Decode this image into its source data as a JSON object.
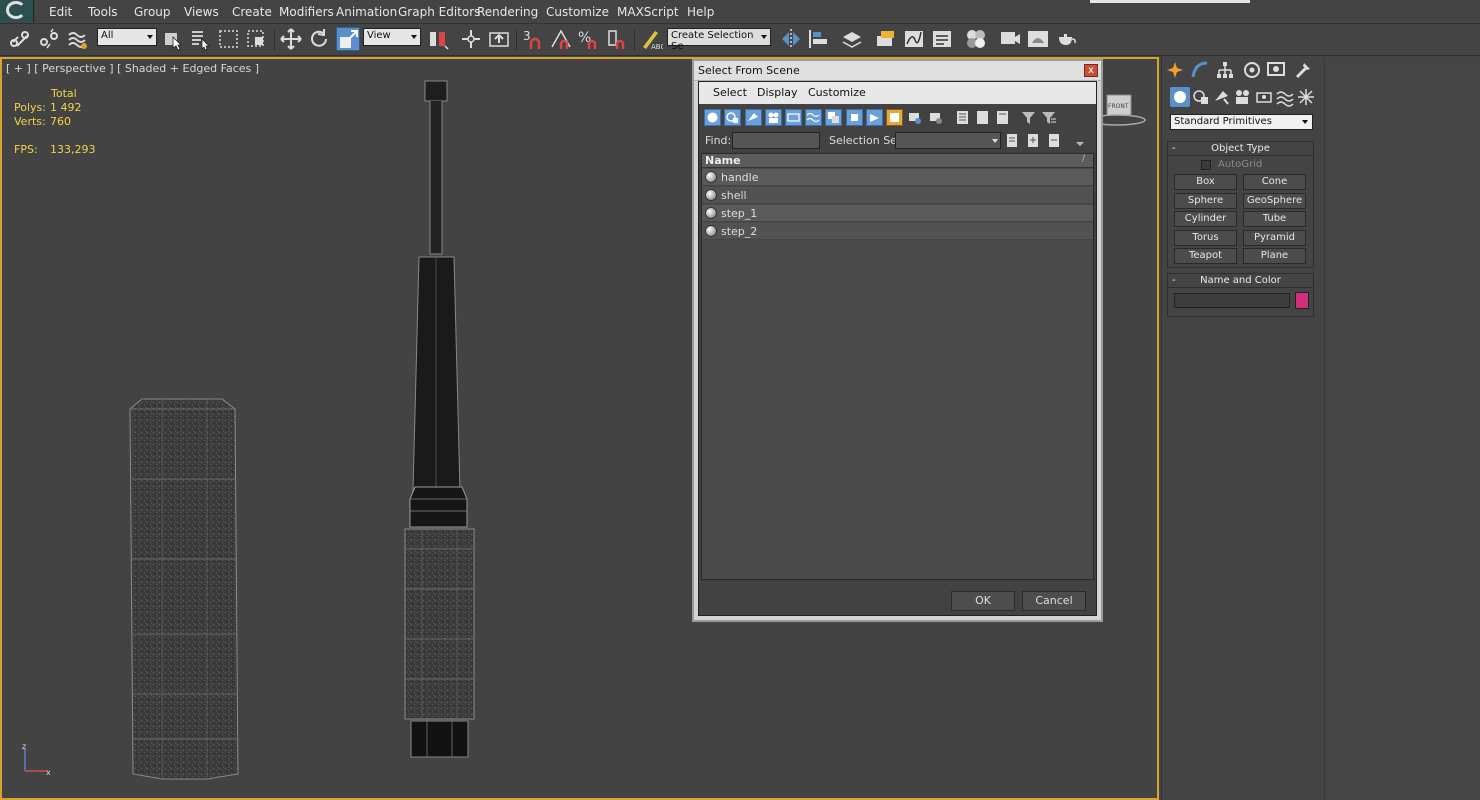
{
  "menubar": {
    "items": [
      "Edit",
      "Tools",
      "Group",
      "Views",
      "Create",
      "Modifiers",
      "Animation",
      "Graph Editors",
      "Rendering",
      "Customize",
      "MAXScript",
      "Help"
    ]
  },
  "toolbar": {
    "selection_filter": "All",
    "reference_coord": "View",
    "angle_snap": "3",
    "named_selection_placeholder": "Create Selection Se"
  },
  "viewport": {
    "label": "[ + ] [ Perspective ] [ Shaded + Edged Faces ]",
    "stats": {
      "header": "Total",
      "polys_label": "Polys:",
      "polys_value": "1 492",
      "verts_label": "Verts:",
      "verts_value": "760",
      "fps_label": "FPS:",
      "fps_value": "133,293"
    },
    "axis_labels": {
      "z": "z",
      "x": "x"
    },
    "viewcube_label": "FRONT",
    "border_color": "#d7a22e"
  },
  "command_panel": {
    "category_value": "Standard Primitives",
    "object_type": {
      "title": "Object Type",
      "autogrid_label": "AutoGrid",
      "buttons": [
        "Box",
        "Cone",
        "Sphere",
        "GeoSphere",
        "Cylinder",
        "Tube",
        "Torus",
        "Pyramid",
        "Teapot",
        "Plane"
      ]
    },
    "name_and_color": {
      "title": "Name and Color",
      "name_value": "",
      "color": "#d0307a"
    }
  },
  "dialog": {
    "title": "Select From Scene",
    "close_symbol": "x",
    "menu": [
      "Select",
      "Display",
      "Customize"
    ],
    "find_label": "Find:",
    "find_value": "",
    "selection_set_label": "Selection Set:",
    "selection_set_value": "",
    "list_header": "Name",
    "list_sort_symbol": "/",
    "rows": [
      "handle",
      "shell",
      "step_1",
      "step_2"
    ],
    "ok_label": "OK",
    "cancel_label": "Cancel"
  }
}
